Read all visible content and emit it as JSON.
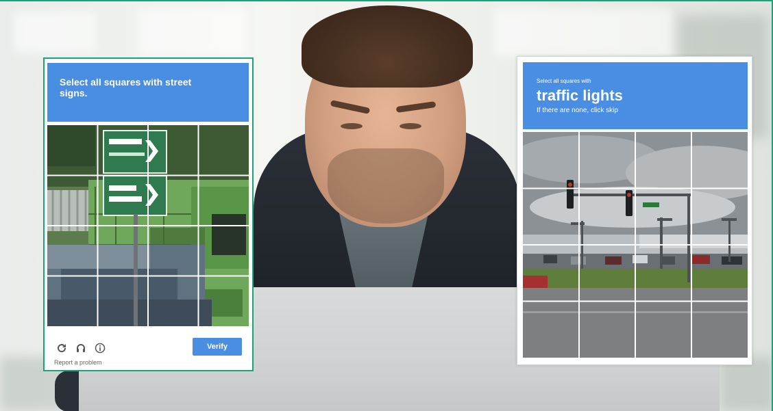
{
  "left_captcha": {
    "instruction": "Select all squares with street signs.",
    "verify_label": "Verify",
    "report_label": "Report a problem",
    "icons": [
      "reload-icon",
      "audio-icon",
      "info-icon"
    ],
    "grid_rows": 4,
    "grid_cols": 4,
    "accent_color": "#4a8ee4",
    "border_color": "#1aa37a"
  },
  "right_captcha": {
    "instruction_small": "Select all squares with",
    "instruction_big": "traffic lights",
    "instruction_hint": "If there are none, click skip",
    "grid_rows": 4,
    "grid_cols": 4,
    "accent_color": "#4a8ee4"
  }
}
